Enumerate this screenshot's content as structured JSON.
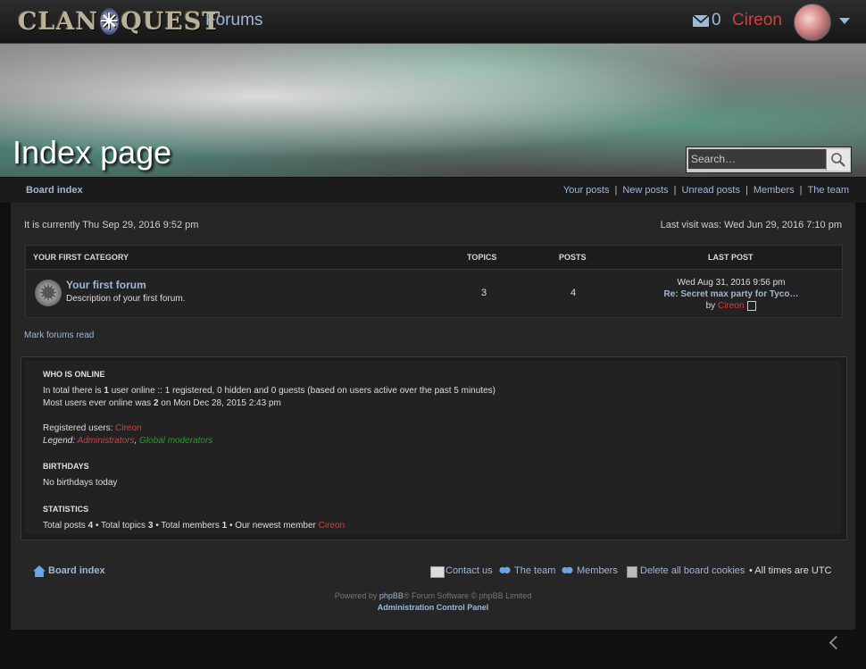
{
  "header": {
    "logo_text": "ClanQuest",
    "forums_label": "Forums",
    "message_count": "0",
    "username": "Cireon"
  },
  "banner": {
    "page_title": "Index page",
    "search_placeholder": "Search…"
  },
  "navbar": {
    "board_index": "Board index",
    "links": [
      "Your posts",
      "New posts",
      "Unread posts",
      "Members",
      "The team"
    ]
  },
  "main": {
    "current_time": "It is currently Thu Sep 29, 2016 9:52 pm",
    "last_visit": "Last visit was: Wed Jun 29, 2016 7:10 pm",
    "category": {
      "title": "YOUR FIRST CATEGORY",
      "col_topics": "TOPICS",
      "col_posts": "POSTS",
      "col_last_post": "LAST POST"
    },
    "forum": {
      "name": "Your first forum",
      "description": "Description of your first forum.",
      "topics": "3",
      "posts": "4",
      "last_post_date": "Wed Aug 31, 2016 9:56 pm",
      "last_post_subject": "Re: Secret max party for Tyco…",
      "last_post_by": "by",
      "last_post_user": "Cireon"
    },
    "mark_read": "Mark forums read"
  },
  "stats": {
    "who_online_title": "WHO IS ONLINE",
    "online_line_prefix": "In total there is",
    "online_total": "1",
    "online_line_suffix": "user online :: 1 registered, 0 hidden and 0 guests (based on users active over the past 5 minutes)",
    "most_line_prefix": "Most users ever online was",
    "most_total": "2",
    "most_line_suffix": "on Mon Dec 28, 2015 2:43 pm",
    "registered_label": "Registered users:",
    "registered_user": "Cireon",
    "legend_label": "Legend:",
    "legend_admins": "Administrators",
    "legend_comma": ",",
    "legend_mods": "Global moderators",
    "birthdays_title": "BIRTHDAYS",
    "birthdays_text": "No birthdays today",
    "statistics_title": "STATISTICS",
    "total_posts_label": "Total posts",
    "total_posts": "4",
    "total_topics_label": "• Total topics",
    "total_topics": "3",
    "total_members_label": "• Total members",
    "total_members": "1",
    "newest_member_label": "• Our newest member",
    "newest_member": "Cireon"
  },
  "footer": {
    "board_index": "Board index",
    "contact_us": "Contact us",
    "the_team": "The team",
    "members": "Members",
    "delete_cookies": "Delete all board cookies",
    "all_times": "•  All times are UTC",
    "powered_prefix": "Powered by",
    "powered_link": "phpBB",
    "powered_suffix": "® Forum Software © phpBB Limited",
    "acp": "Administration Control Panel"
  },
  "colors": {
    "link": "#9db7d7",
    "username_red": "#d14040",
    "moderator_green": "#2a9a2a",
    "panel_bg": "#262626"
  }
}
